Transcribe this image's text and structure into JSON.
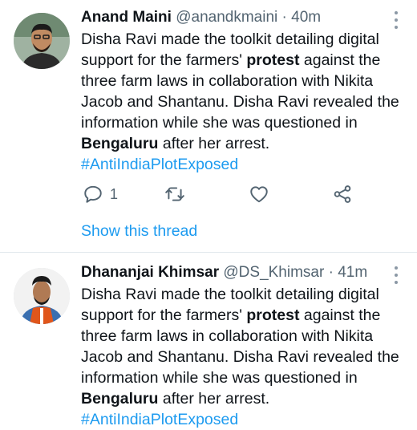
{
  "tweets": [
    {
      "author_name": "Anand Maini",
      "handle": "@anandkmaini",
      "separator": "·",
      "time": "40m",
      "text_1": "Disha Ravi made the toolkit detailing digital support for the farmers' ",
      "bold_1": "protest",
      "text_2": " against the three farm laws in collaboration with Nikita Jacob and Shantanu. Disha Ravi revealed the information while she was questioned in ",
      "bold_2": "Bengaluru",
      "text_3": " after her arrest.",
      "hashtag": "#AntiIndiaPlotExposed",
      "reply_count": "1",
      "show_thread": "Show this thread"
    },
    {
      "author_name": "Dhananjai Khimsar",
      "handle": "@DS_Khimsar",
      "separator": "·",
      "time": "41m",
      "text_1": "Disha Ravi made the toolkit detailing digital support for the farmers' ",
      "bold_1": "protest",
      "text_2": " against the three farm laws in collaboration with Nikita Jacob and Shantanu. Disha Ravi revealed the information while she was questioned in ",
      "bold_2": "Bengaluru",
      "text_3": " after her arrest.",
      "hashtag": "#AntiIndiaPlotExposed"
    }
  ],
  "icons": [
    "more-icon",
    "reply-icon",
    "retweet-icon",
    "like-icon",
    "share-icon"
  ],
  "colors": {
    "link": "#1d9bf0",
    "secondary_text": "#536471",
    "divider": "#e1e8ed"
  }
}
